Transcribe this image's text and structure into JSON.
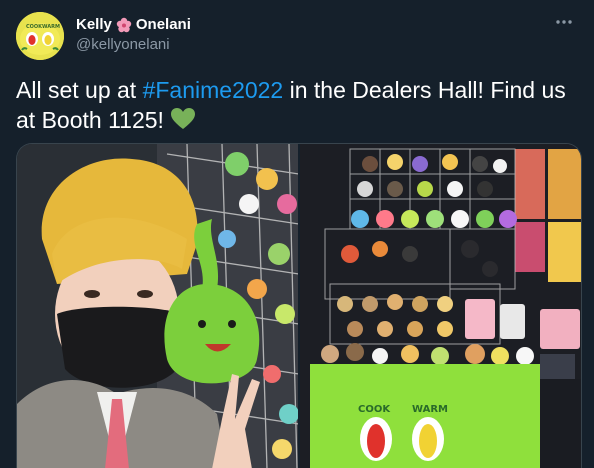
{
  "author": {
    "display_name_first": "Kelly",
    "display_name_last": "Onelani",
    "handle": "@kellyonelani",
    "avatar_icon": "yellow-plush-avatar",
    "name_emoji_icon": "hibiscus-icon",
    "avatar_text_left": "COOK",
    "avatar_text_right": "WARM"
  },
  "menu": {
    "icon": "more-options-icon"
  },
  "tweet": {
    "text_before": "All set up at ",
    "hashtag": "#Fanime2022",
    "text_after": " in the Dealers Hall! Find us at Booth 1125! ",
    "emoji_icon": "green-heart-icon"
  },
  "media": {
    "photo_left_name": "selfie-with-plush-photo",
    "photo_right_name": "booth-display-photo",
    "table_label_left": "COOK",
    "table_label_right": "WARM"
  },
  "colors": {
    "background": "#15202b",
    "link": "#1d9bf0",
    "secondary_text": "#8b98a5",
    "heart": "#78b159"
  }
}
